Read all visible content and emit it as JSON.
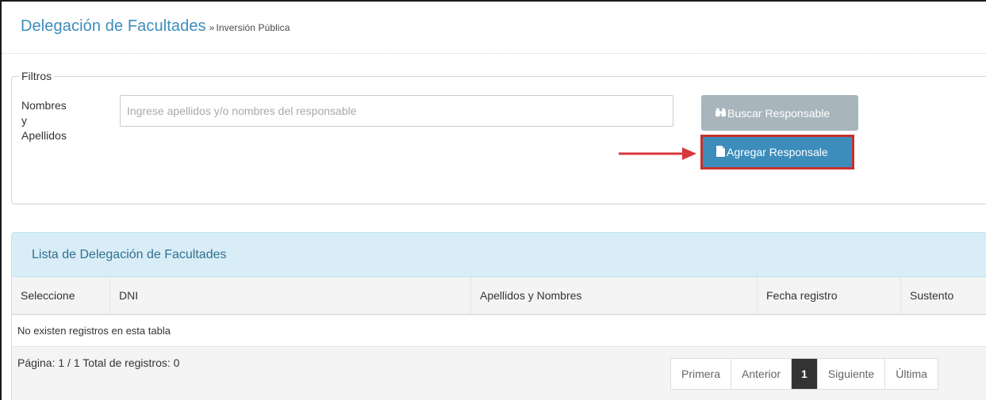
{
  "header": {
    "title": "Delegación de Facultades",
    "separator": "»",
    "subtitle": "Inversión Pública"
  },
  "filters": {
    "legend": "Filtros",
    "name_label_lines": [
      "Nombres",
      "y",
      "Apellidos"
    ],
    "search": {
      "placeholder": "Ingrese apellidos y/o nombres del responsable",
      "value": ""
    },
    "search_button": {
      "label": "Buscar Responsable",
      "icon": "binoculars-icon"
    },
    "add_button": {
      "label": "Agregar Responsale",
      "icon": "file-icon"
    },
    "annotation": {
      "type": "arrow",
      "color": "#d9393c"
    }
  },
  "list": {
    "heading": "Lista de Delegación de Facultades",
    "columns": [
      "Seleccione",
      "DNI",
      "Apellidos y Nombres",
      "Fecha registro",
      "Sustento"
    ],
    "empty_message": "No existen registros en esta tabla",
    "footer": "Página: 1 / 1 Total de registros: 0",
    "pagination": {
      "first": "Primera",
      "prev": "Anterior",
      "current": "1",
      "next": "Siguiente",
      "last": "Última"
    }
  },
  "colors": {
    "accent": "#3c8dbc",
    "highlight_border": "#c9302c",
    "panel_heading_bg": "#d9edf7",
    "disabled_button": "#a9b5bd"
  }
}
